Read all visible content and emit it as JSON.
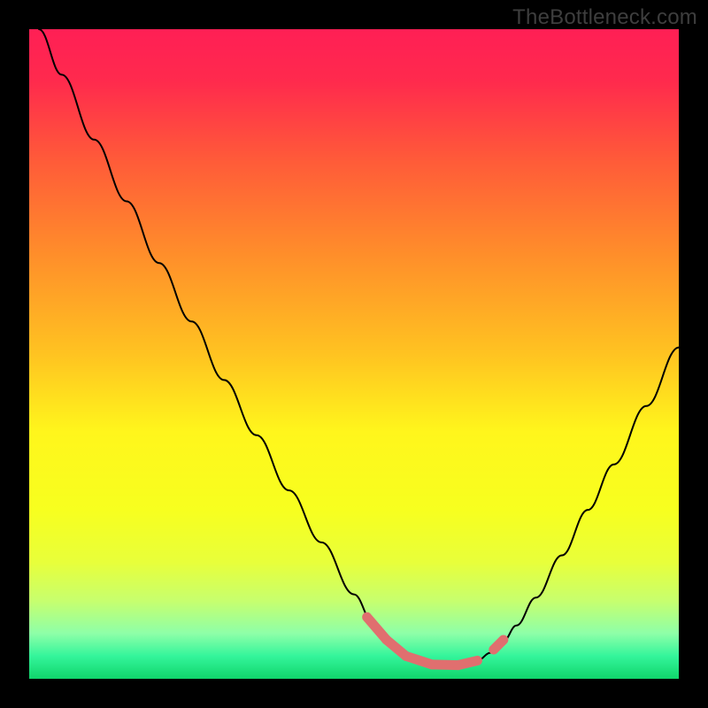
{
  "watermark": "TheBottleneck.com",
  "chart_data": {
    "type": "line",
    "title": "",
    "xlabel": "",
    "ylabel": "",
    "xlim": [
      0,
      100
    ],
    "ylim": [
      0,
      100
    ],
    "gradient_stops": [
      {
        "offset": 0.0,
        "color": "#ff1f55"
      },
      {
        "offset": 0.08,
        "color": "#ff2a4d"
      },
      {
        "offset": 0.2,
        "color": "#ff5a39"
      },
      {
        "offset": 0.35,
        "color": "#ff8f2a"
      },
      {
        "offset": 0.5,
        "color": "#ffc321"
      },
      {
        "offset": 0.62,
        "color": "#fff61c"
      },
      {
        "offset": 0.74,
        "color": "#f7ff1f"
      },
      {
        "offset": 0.82,
        "color": "#e8ff3a"
      },
      {
        "offset": 0.88,
        "color": "#c7ff6e"
      },
      {
        "offset": 0.93,
        "color": "#8effa8"
      },
      {
        "offset": 0.965,
        "color": "#34f59b"
      },
      {
        "offset": 1.0,
        "color": "#10d56b"
      }
    ],
    "series": [
      {
        "name": "curve",
        "color": "#000000",
        "points": [
          {
            "x": 1.5,
            "y": 100.0
          },
          {
            "x": 5.0,
            "y": 93.0
          },
          {
            "x": 10.0,
            "y": 83.0
          },
          {
            "x": 15.0,
            "y": 73.5
          },
          {
            "x": 20.0,
            "y": 64.0
          },
          {
            "x": 25.0,
            "y": 55.0
          },
          {
            "x": 30.0,
            "y": 46.0
          },
          {
            "x": 35.0,
            "y": 37.5
          },
          {
            "x": 40.0,
            "y": 29.0
          },
          {
            "x": 45.0,
            "y": 21.0
          },
          {
            "x": 50.0,
            "y": 13.0
          },
          {
            "x": 53.0,
            "y": 8.5
          },
          {
            "x": 55.0,
            "y": 6.0
          },
          {
            "x": 57.0,
            "y": 4.2
          },
          {
            "x": 59.0,
            "y": 3.0
          },
          {
            "x": 61.0,
            "y": 2.3
          },
          {
            "x": 63.0,
            "y": 2.0
          },
          {
            "x": 65.0,
            "y": 2.0
          },
          {
            "x": 67.0,
            "y": 2.2
          },
          {
            "x": 69.0,
            "y": 2.8
          },
          {
            "x": 71.0,
            "y": 4.0
          },
          {
            "x": 73.0,
            "y": 5.8
          },
          {
            "x": 75.0,
            "y": 8.2
          },
          {
            "x": 78.0,
            "y": 12.5
          },
          {
            "x": 82.0,
            "y": 19.0
          },
          {
            "x": 86.0,
            "y": 26.0
          },
          {
            "x": 90.0,
            "y": 33.0
          },
          {
            "x": 95.0,
            "y": 42.0
          },
          {
            "x": 100.0,
            "y": 51.0
          }
        ]
      }
    ],
    "highlight": {
      "color": "#e06f6f",
      "segments": [
        {
          "x1": 52.0,
          "y1": 9.5,
          "x2": 55.0,
          "y2": 6.0
        },
        {
          "x1": 55.0,
          "y1": 6.0,
          "x2": 58.0,
          "y2": 3.5
        },
        {
          "x1": 58.0,
          "y1": 3.5,
          "x2": 62.0,
          "y2": 2.2
        },
        {
          "x1": 62.0,
          "y1": 2.2,
          "x2": 66.0,
          "y2": 2.1
        },
        {
          "x1": 66.0,
          "y1": 2.1,
          "x2": 69.0,
          "y2": 2.8
        },
        {
          "x1": 71.5,
          "y1": 4.5,
          "x2": 73.0,
          "y2": 6.0
        }
      ]
    }
  }
}
